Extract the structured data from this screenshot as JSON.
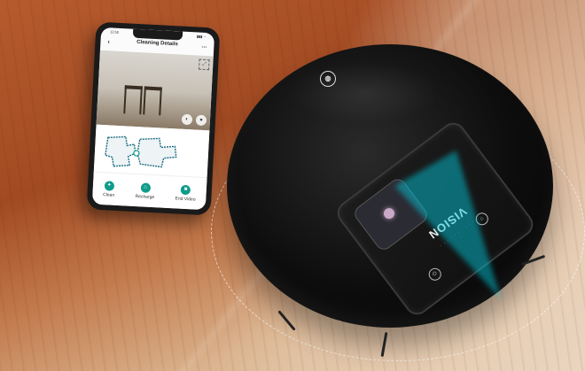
{
  "phone": {
    "status_time": "12:50",
    "status_icons": "▮▮▮ ◔",
    "header_title": "Cleaning Details",
    "back_icon": "back-arrow-icon",
    "share_icon": "share-icon",
    "actions": [
      {
        "label": "Clean",
        "icon": "clean-icon"
      },
      {
        "label": "Recharge",
        "icon": "recharge-icon"
      },
      {
        "label": "End Video",
        "icon": "end-video-icon"
      }
    ]
  },
  "robot": {
    "brand_text": "VISION",
    "sub_text": "· · · · · · · · · ·",
    "logo_icon": "brand-logo-icon",
    "beam_color": "#00d2e6"
  },
  "colors": {
    "table": "#a24a22",
    "floor": "#e6cdb2",
    "app_accent": "#0f9c8a"
  }
}
